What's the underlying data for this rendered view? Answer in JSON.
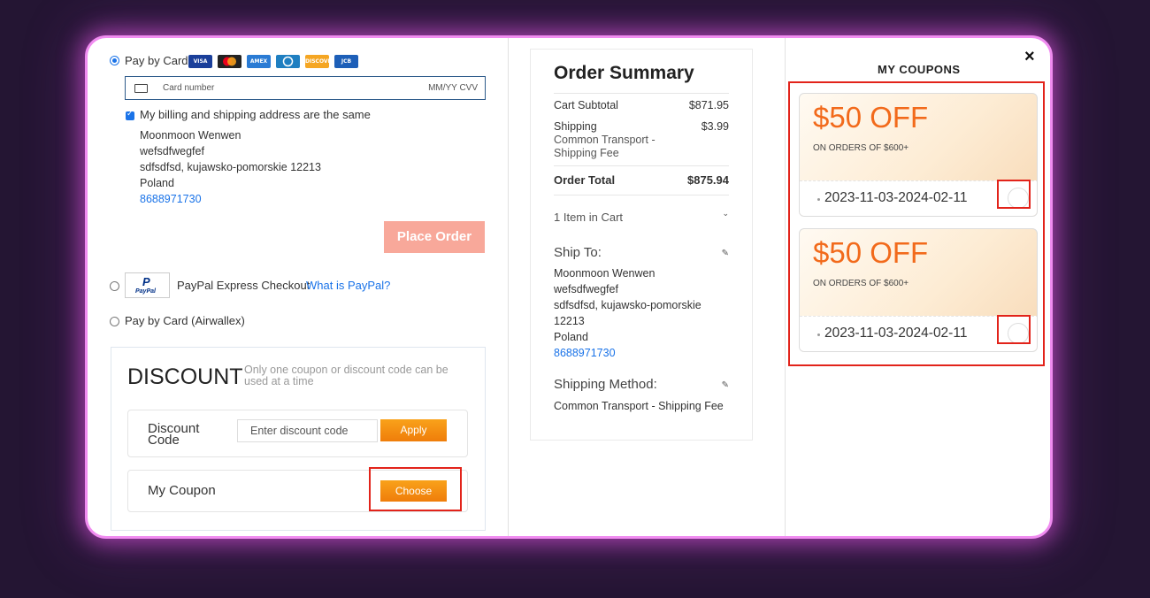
{
  "payment": {
    "card_label": "Pay by Card",
    "card_logos": [
      "VISA",
      "MC",
      "AMEX",
      "DINERS",
      "DISCOVER",
      "JCB"
    ],
    "card_number_placeholder": "Card number",
    "expiry_cvv_placeholder": "MM/YY CVV",
    "same_address_label": "My billing and shipping address are the same",
    "address": {
      "name": "Moonmoon Wenwen",
      "line1": "wefsdfwegfef",
      "line2": "sdfsdfsd, kujawsko-pomorskie 12213",
      "country": "Poland",
      "phone": "8688971730"
    },
    "place_order_label": "Place Order",
    "paypal_logo_text": "PayPal",
    "paypal_label": "PayPal Express Checkout",
    "paypal_link": "What is PayPal?",
    "airwallex_label": "Pay by Card (Airwallex)"
  },
  "discount": {
    "title": "DISCOUNT",
    "note": "Only one coupon or discount code can be used at a time",
    "code_label": "Discount Code",
    "code_placeholder": "Enter discount code",
    "apply_label": "Apply",
    "coupon_label": "My Coupon",
    "choose_label": "Choose"
  },
  "summary": {
    "title": "Order Summary",
    "subtotal_label": "Cart Subtotal",
    "subtotal_value": "$871.95",
    "shipping_label": "Shipping",
    "shipping_value": "$3.99",
    "shipping_method_short": "Common Transport - Shipping Fee",
    "total_label": "Order Total",
    "total_value": "$875.94",
    "items_in_cart": "1 Item in Cart",
    "ship_to_label": "Ship To:",
    "ship_address": {
      "name": "Moonmoon Wenwen",
      "line1": "wefsdfwegfef",
      "line2": "sdfsdfsd, kujawsko-pomorskie",
      "zip": "12213",
      "country": "Poland",
      "phone": "8688971730"
    },
    "shipping_method_label": "Shipping Method:",
    "shipping_method_value": "Common Transport - Shipping Fee"
  },
  "coupons": {
    "title": "MY COUPONS",
    "close_icon": "×",
    "items": [
      {
        "amount": "$50 OFF",
        "condition": "ON ORDERS OF $600+",
        "dates": "2023-11-03-2024-02-11"
      },
      {
        "amount": "$50 OFF",
        "condition": "ON ORDERS OF $600+",
        "dates": "2023-11-03-2024-02-11"
      }
    ]
  },
  "colors": {
    "accent_blue": "#1a73e8",
    "coupon_orange": "#f26a1b",
    "highlight_red": "#e2231a",
    "frame_glow": "#f08cf0"
  }
}
